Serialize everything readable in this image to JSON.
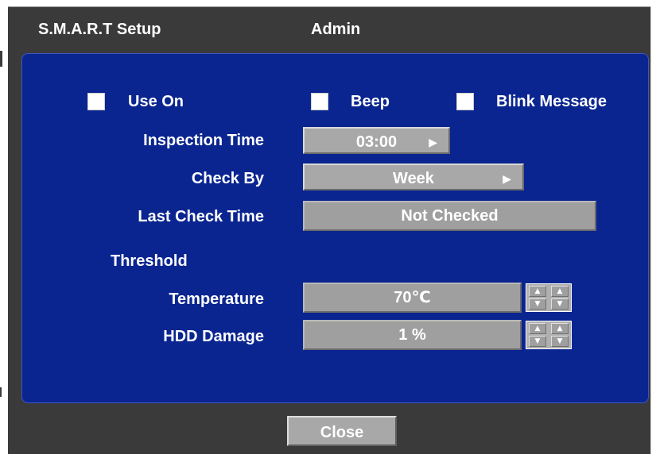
{
  "window": {
    "title": "S.M.A.R.T Setup",
    "user": "Admin"
  },
  "options": {
    "use_on": {
      "label": "Use On",
      "checked": false
    },
    "beep": {
      "label": "Beep",
      "checked": false
    },
    "blink_message": {
      "label": "Blink Message",
      "checked": false
    }
  },
  "inspection_time": {
    "label": "Inspection Time",
    "value": "03:00"
  },
  "check_by": {
    "label": "Check By",
    "value": "Week"
  },
  "last_check_time": {
    "label": "Last Check Time",
    "value": "Not Checked"
  },
  "threshold": {
    "label": "Threshold",
    "temperature": {
      "label": "Temperature",
      "value": "70℃"
    },
    "hdd_damage": {
      "label": "HDD Damage",
      "value": "1 %"
    }
  },
  "footer": {
    "close_label": "Close"
  },
  "icons": {
    "dropdown_arrow": "triangle-right",
    "spin_up": "triangle-up",
    "spin_down": "triangle-down"
  },
  "colors": {
    "panel_blue": "#0a2590",
    "window_gray": "#3a3a3a",
    "control_gray": "#a8a8a8"
  }
}
